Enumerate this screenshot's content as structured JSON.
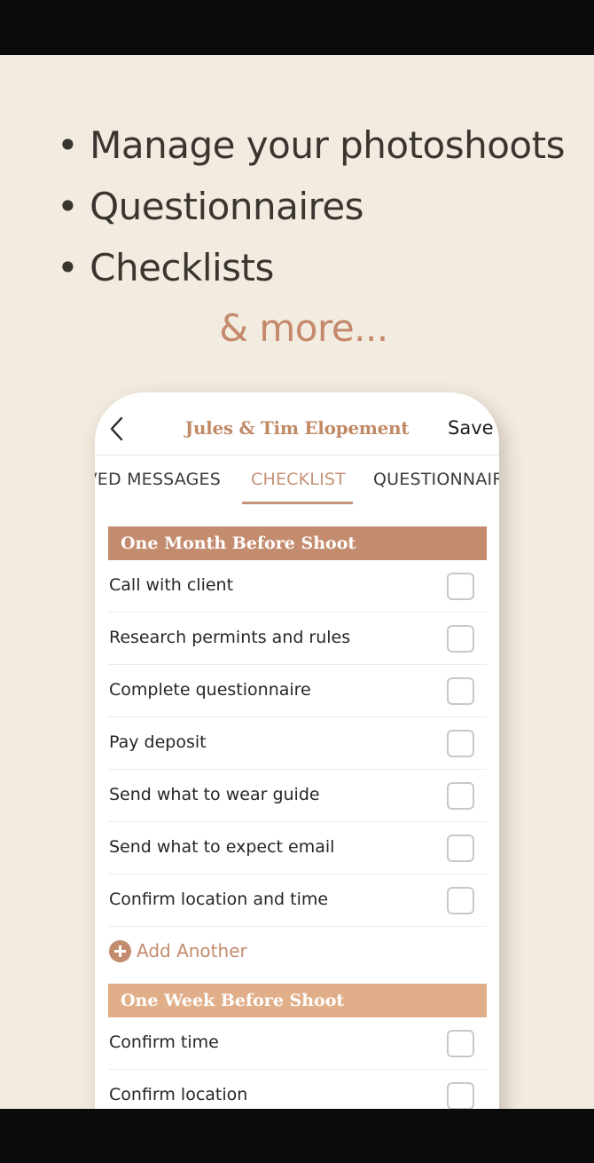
{
  "promo": {
    "bullets": [
      "• Manage your photoshoots",
      "• Questionnaires",
      "• Checklists"
    ],
    "more": "& more..."
  },
  "app": {
    "title": "Jules & Tim Elopement",
    "save_label": "Save",
    "tabs": {
      "prev": "VED MESSAGES",
      "active": "CHECKLIST",
      "next": "QUESTIONNAIRES"
    },
    "sections": [
      {
        "title": "One Month Before Shoot",
        "items": [
          "Call with client",
          "Research permints and rules",
          "Complete questionnaire",
          "Pay deposit",
          "Send what to wear guide",
          "Send what to expect email",
          "Confirm location and time"
        ],
        "add_label": "Add Another"
      },
      {
        "title": "One Week Before Shoot",
        "items": [
          "Confirm time",
          "Confirm location"
        ]
      }
    ],
    "colors": {
      "accent": "#c48c6e",
      "section_2": "#e0ae89",
      "background": "#f2ebe0"
    }
  }
}
